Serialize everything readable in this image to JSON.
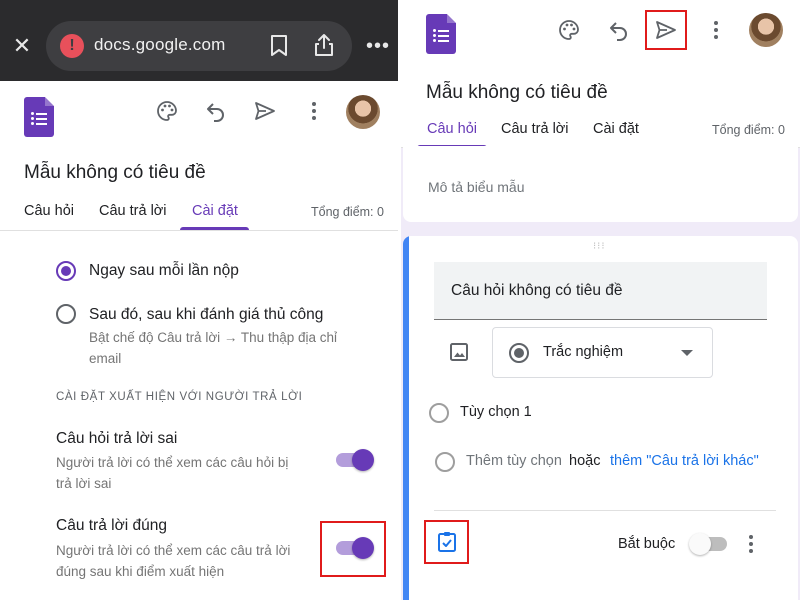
{
  "browser": {
    "url": "docs.google.com",
    "icons": [
      "close-icon",
      "warning-icon",
      "bookmark-icon",
      "share-icon",
      "more-horizontal-icon"
    ]
  },
  "left": {
    "form_title": "Mẫu không có tiêu đề",
    "tabs": [
      {
        "label": "Câu hỏi",
        "active": false
      },
      {
        "label": "Câu trả lời",
        "active": false
      },
      {
        "label": "Cài đặt",
        "active": true
      }
    ],
    "total_points": "Tổng điểm: 0",
    "release_options": [
      {
        "label": "Ngay sau mỗi lần nộp",
        "selected": true,
        "sub": ""
      },
      {
        "label": "Sau đó, sau khi đánh giá thủ công",
        "selected": false,
        "sub_line1": "Bật chế độ Câu trả lời → Thu thập địa chỉ",
        "sub_line2": "email"
      }
    ],
    "section_caption": "CÀI ĐẶT XUẤT HIỆN VỚI NGƯỜI TRẢ LỜI",
    "settings": [
      {
        "title": "Câu hỏi trả lời sai",
        "line1": "Người trả lời có thể xem các câu hỏi bị",
        "line2": "trả lời sai",
        "enabled": true
      },
      {
        "title": "Câu trả lời đúng",
        "line1": "Người trả lời có thể xem các câu trả lời",
        "line2": "đúng sau khi điểm xuất hiện",
        "enabled": true
      }
    ]
  },
  "right": {
    "form_title": "Mẫu không có tiêu đề",
    "tabs": [
      {
        "label": "Câu hỏi",
        "active": true
      },
      {
        "label": "Câu trả lời",
        "active": false
      },
      {
        "label": "Cài đặt",
        "active": false
      }
    ],
    "total_points": "Tổng điểm: 0",
    "form_description_placeholder": "Mô tả biểu mẫu",
    "question": {
      "title": "Câu hỏi không có tiêu đề",
      "type": "Trắc nghiệm",
      "options": [
        "Tùy chọn 1"
      ],
      "add_option": "Thêm tùy chọn",
      "or": "hoặc",
      "add_other": "thêm \"Câu trả lời khác\"",
      "required_label": "Bắt buộc",
      "required": false
    }
  },
  "colors": {
    "accent": "#673ab7",
    "accent_light": "#b39ddb",
    "link": "#1a73e8",
    "question_bar": "#4285f4",
    "highlight_box": "#e01b1b",
    "form_bg": "#f0ebf8"
  }
}
